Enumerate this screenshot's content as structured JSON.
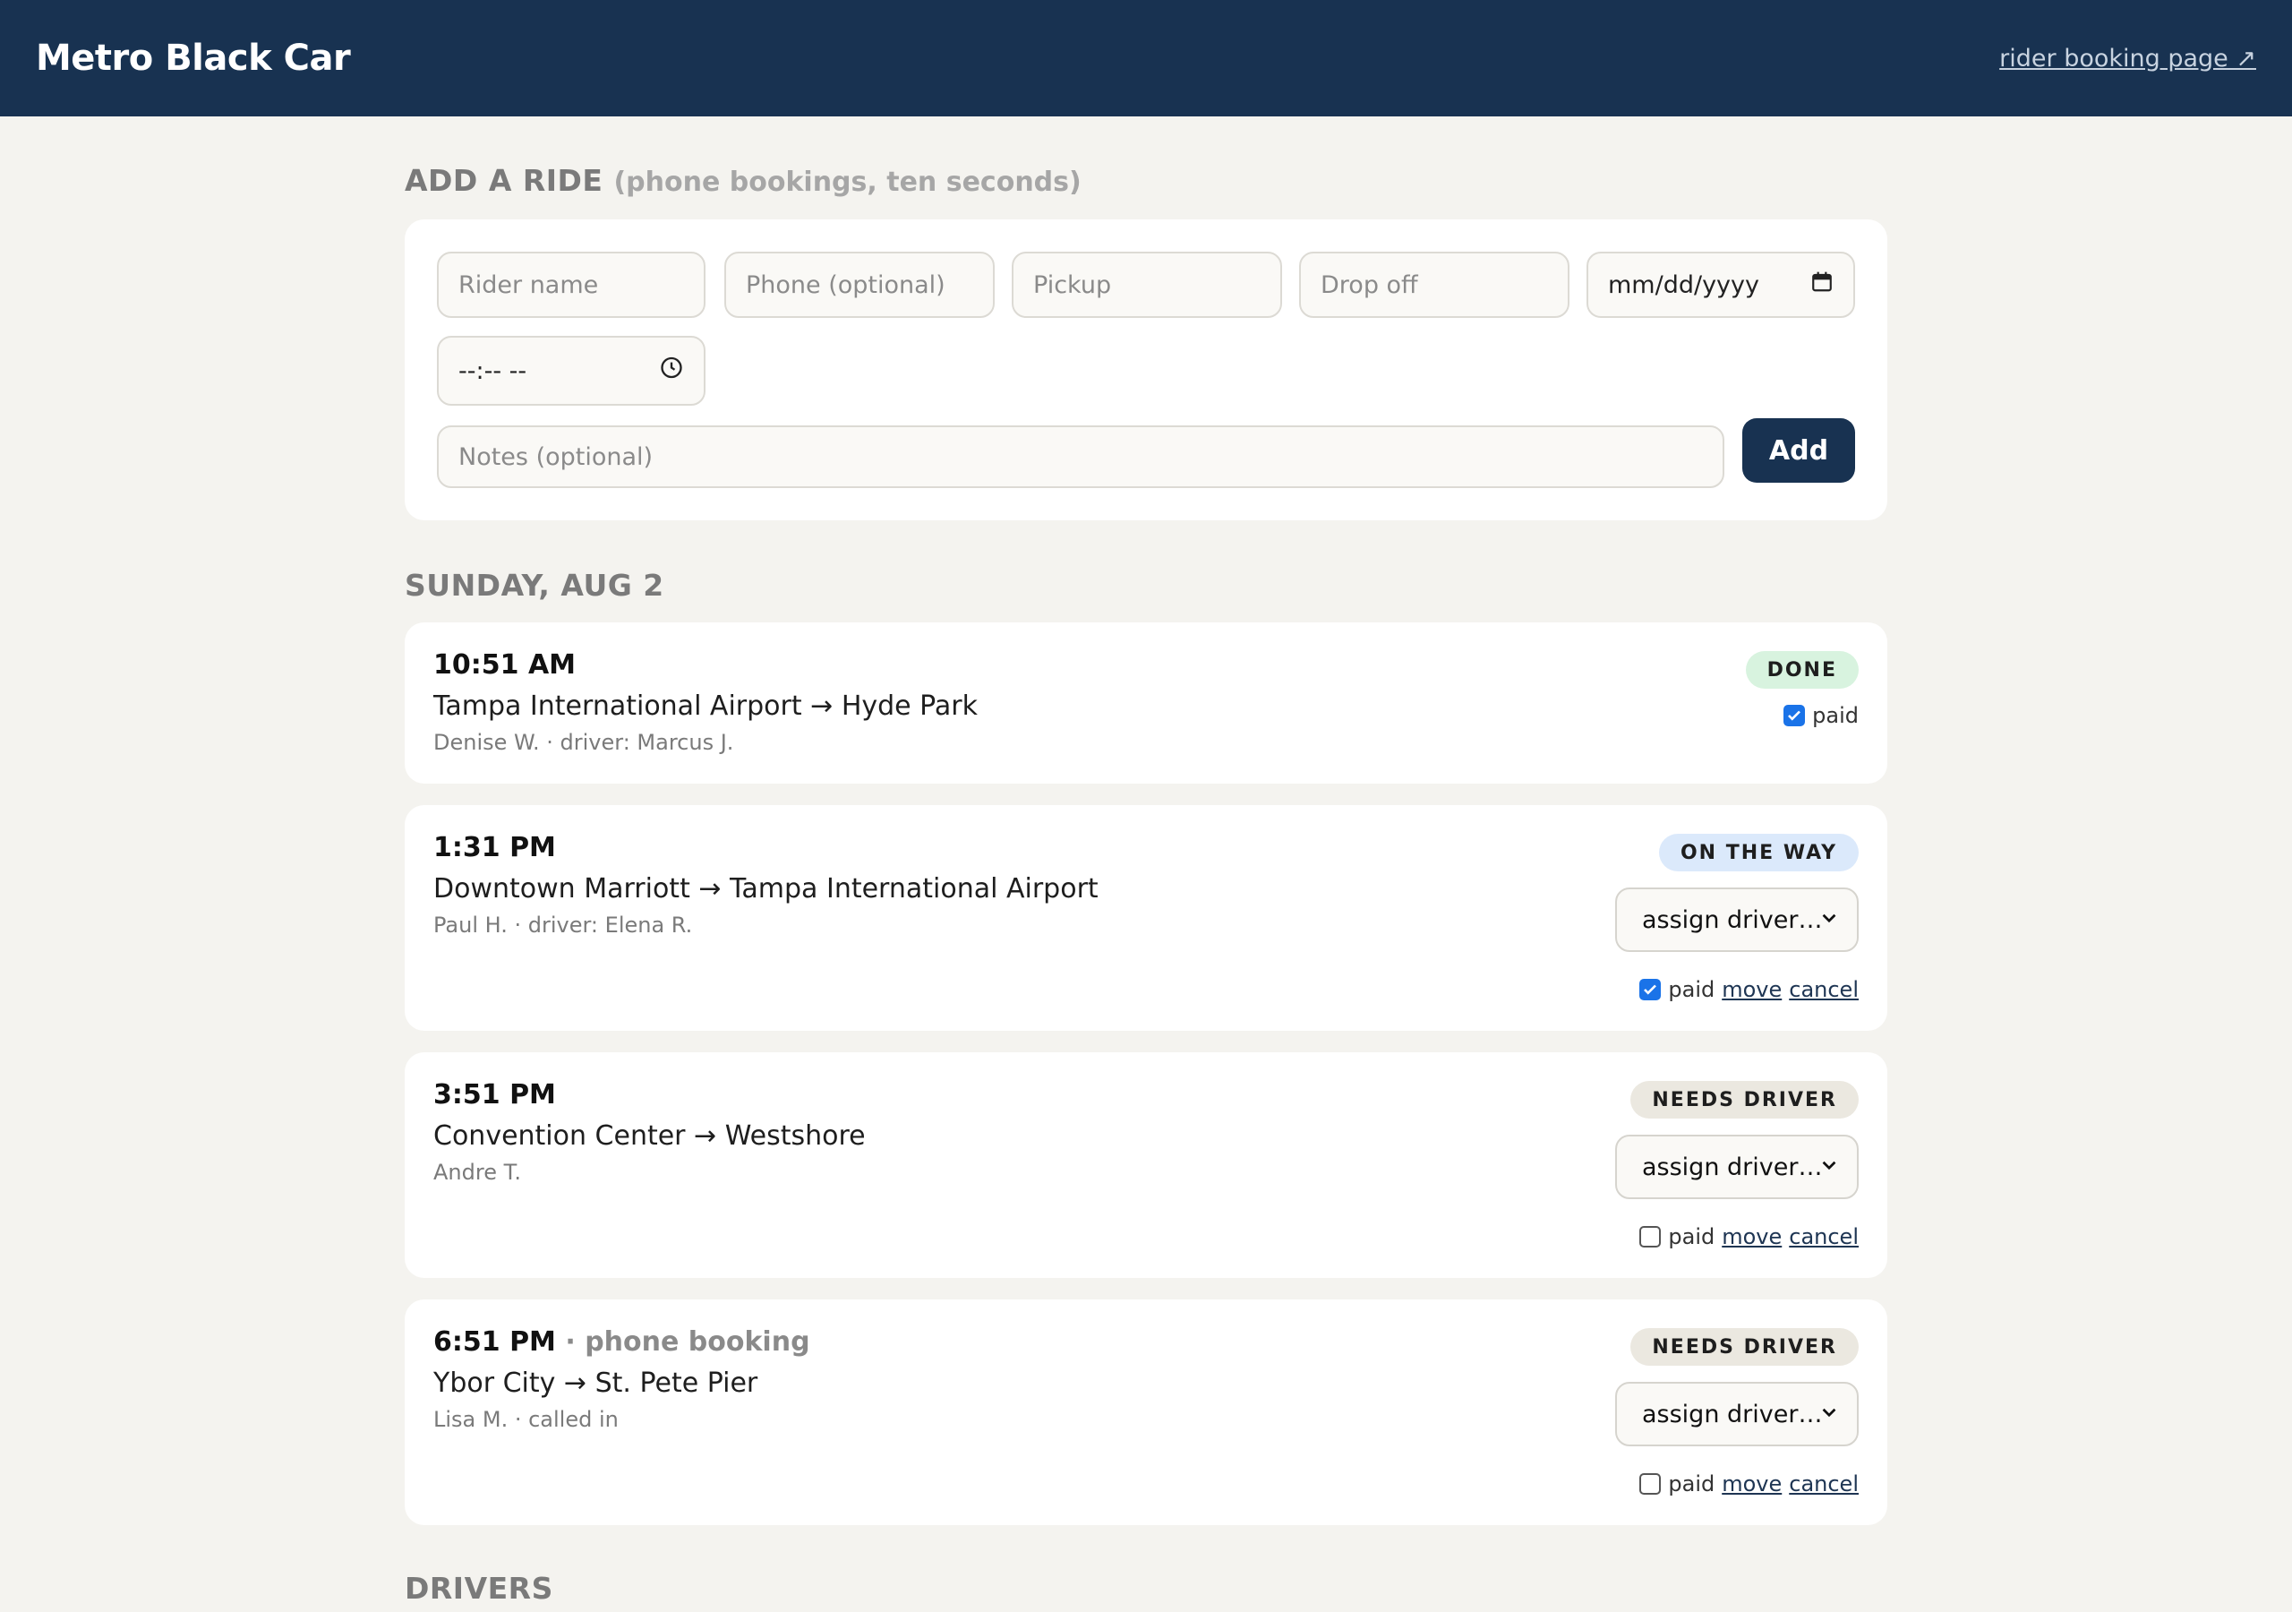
{
  "header": {
    "brand": "Metro Black Car",
    "rider_link": "rider booking page ↗"
  },
  "add_ride": {
    "title": "ADD A RIDE",
    "subtitle": "(phone bookings, ten seconds)",
    "rider_placeholder": "Rider name",
    "phone_placeholder": "Phone (optional)",
    "pickup_placeholder": "Pickup",
    "dropoff_placeholder": "Drop off",
    "date_value": "mm/dd/yyyy",
    "time_value": "--:-- --",
    "notes_placeholder": "Notes (optional)",
    "add_label": "Add"
  },
  "day": {
    "title": "SUNDAY, AUG 2"
  },
  "rides": [
    {
      "time": "10:51 AM",
      "tag": "",
      "route": "Tampa International Airport → Hyde Park",
      "meta": "Denise W. · driver: Marcus J.",
      "status": "DONE",
      "paid": true,
      "paid_label": "paid"
    },
    {
      "time": "1:31 PM",
      "tag": "",
      "route": "Downtown Marriott → Tampa International Airport",
      "meta": "Paul H. · driver: Elena R.",
      "status": "ON THE WAY",
      "assign": "assign driver…",
      "paid": true,
      "paid_label": "paid",
      "move": "move",
      "cancel": "cancel"
    },
    {
      "time": "3:51 PM",
      "tag": "",
      "route": "Convention Center → Westshore",
      "meta": "Andre T.",
      "status": "NEEDS DRIVER",
      "assign": "assign driver…",
      "paid": false,
      "paid_label": "paid",
      "move": "move",
      "cancel": "cancel"
    },
    {
      "time": "6:51 PM",
      "tag": " · phone booking",
      "route": "Ybor City → St. Pete Pier",
      "meta": "Lisa M. · called in",
      "status": "NEEDS DRIVER",
      "assign": "assign driver…",
      "paid": false,
      "paid_label": "paid",
      "move": "move",
      "cancel": "cancel"
    }
  ],
  "drivers": {
    "title": "DRIVERS"
  }
}
